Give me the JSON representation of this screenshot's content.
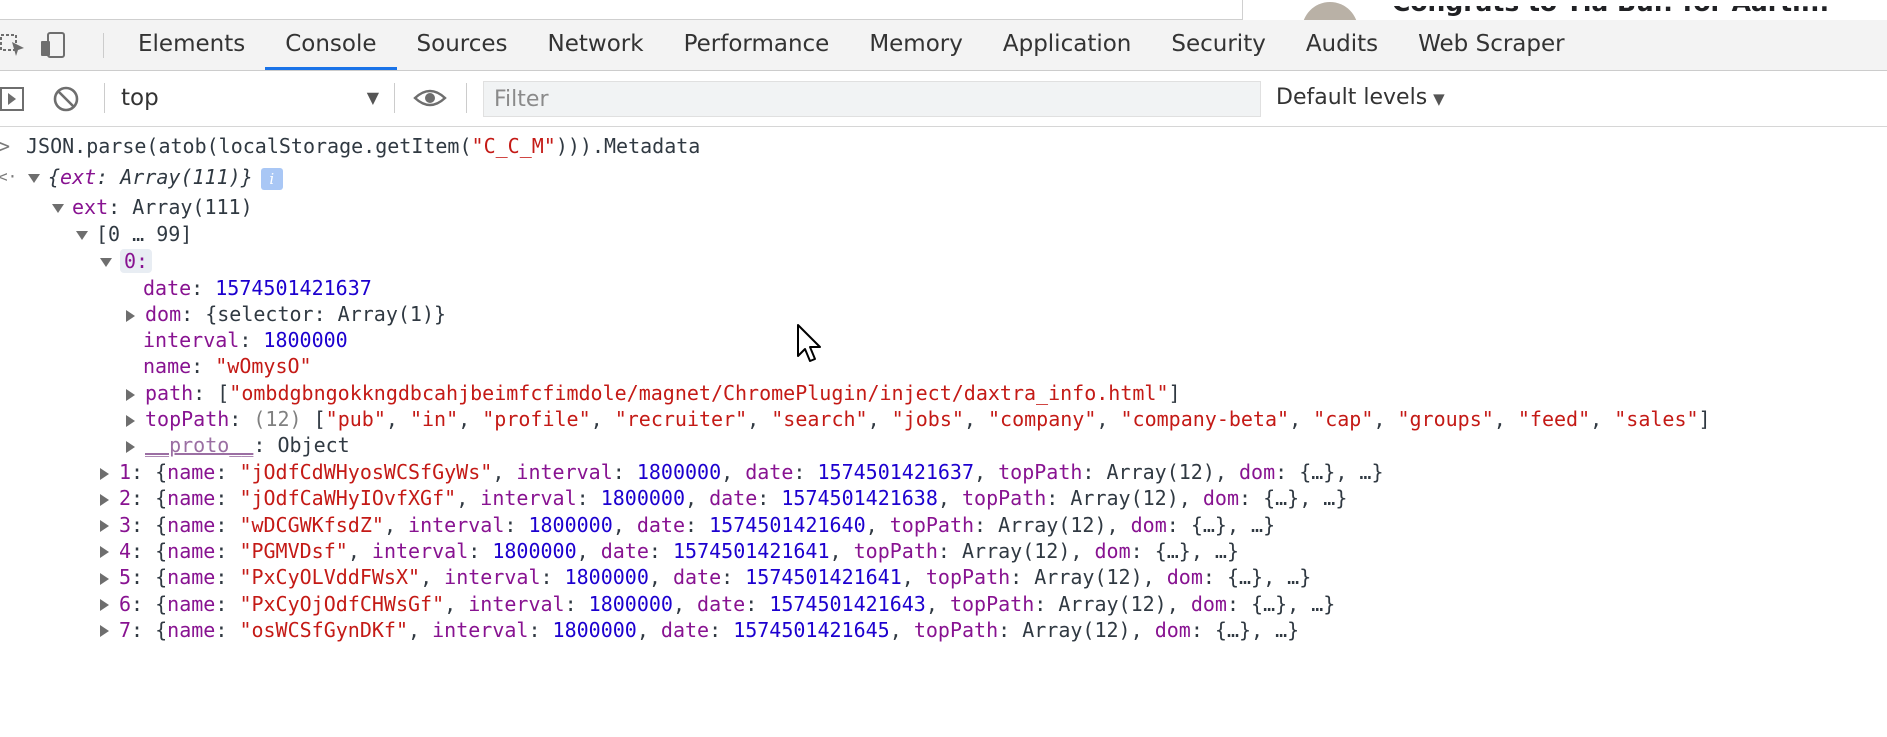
{
  "top_strip": {
    "snippet": "Congrats to Tia Bui! for Aarti..."
  },
  "tabs": [
    "Elements",
    "Console",
    "Sources",
    "Network",
    "Performance",
    "Memory",
    "Application",
    "Security",
    "Audits",
    "Web Scraper"
  ],
  "active_tab": "Console",
  "toolbar": {
    "context": "top",
    "filter_placeholder": "Filter",
    "filter_value": "",
    "levels": "Default levels"
  },
  "console": {
    "input": {
      "pre": "JSON.parse(atob(localStorage.getItem(",
      "str": "\"C_C_M\"",
      "post": "))).Metadata"
    },
    "result_summary": {
      "open": "{",
      "key": "ext",
      "sep": ": ",
      "type": "Array(111)",
      "close": "}"
    },
    "info_icon": "i",
    "ext_line": {
      "key": "ext",
      "sep": ": ",
      "type": "Array(111)"
    },
    "range": "[0 … 99]",
    "item0": {
      "key": "0",
      "colon": ":",
      "date": {
        "key": "date",
        "value": "1574501421637"
      },
      "dom": {
        "key": "dom",
        "value": "{selector: Array(1)}"
      },
      "interval": {
        "key": "interval",
        "value": "1800000"
      },
      "name": {
        "key": "name",
        "value": "\"wOmysO\""
      },
      "path": {
        "key": "path",
        "value": "\"ombdgbngokkngdbcahjbeimfcfimdole/magnet/ChromePlugin/inject/daxtra_info.html\""
      },
      "topPath": {
        "key": "topPath",
        "count": "(12)",
        "values": [
          "\"pub\"",
          "\"in\"",
          "\"profile\"",
          "\"recruiter\"",
          "\"search\"",
          "\"jobs\"",
          "\"company\"",
          "\"company-beta\"",
          "\"cap\"",
          "\"groups\"",
          "\"feed\"",
          "\"sales\""
        ]
      },
      "proto": {
        "key": "__proto__",
        "value": "Object"
      }
    },
    "items": [
      {
        "idx": "1",
        "name": "\"jOdfCdWHyosWCSfGyWs\"",
        "interval": "1800000",
        "date": "1574501421637"
      },
      {
        "idx": "2",
        "name": "\"jOdfCaWHyIOvfXGf\"",
        "interval": "1800000",
        "date": "1574501421638"
      },
      {
        "idx": "3",
        "name": "\"wDCGWKfsdZ\"",
        "interval": "1800000",
        "date": "1574501421640"
      },
      {
        "idx": "4",
        "name": "\"PGMVDsf\"",
        "interval": "1800000",
        "date": "1574501421641"
      },
      {
        "idx": "5",
        "name": "\"PxCyOLVddFWsX\"",
        "interval": "1800000",
        "date": "1574501421641"
      },
      {
        "idx": "6",
        "name": "\"PxCyOjOdfCHWsGf\"",
        "interval": "1800000",
        "date": "1574501421643"
      },
      {
        "idx": "7",
        "name": "\"osWCSfGynDKf\"",
        "interval": "1800000",
        "date": "1574501421645"
      }
    ],
    "item_labels": {
      "name": "name",
      "interval": "interval",
      "date": "date",
      "topPath": "topPath",
      "topPath_val": "Array(12)",
      "dom": "dom",
      "dom_val": "{…}",
      "tail": "…"
    }
  }
}
